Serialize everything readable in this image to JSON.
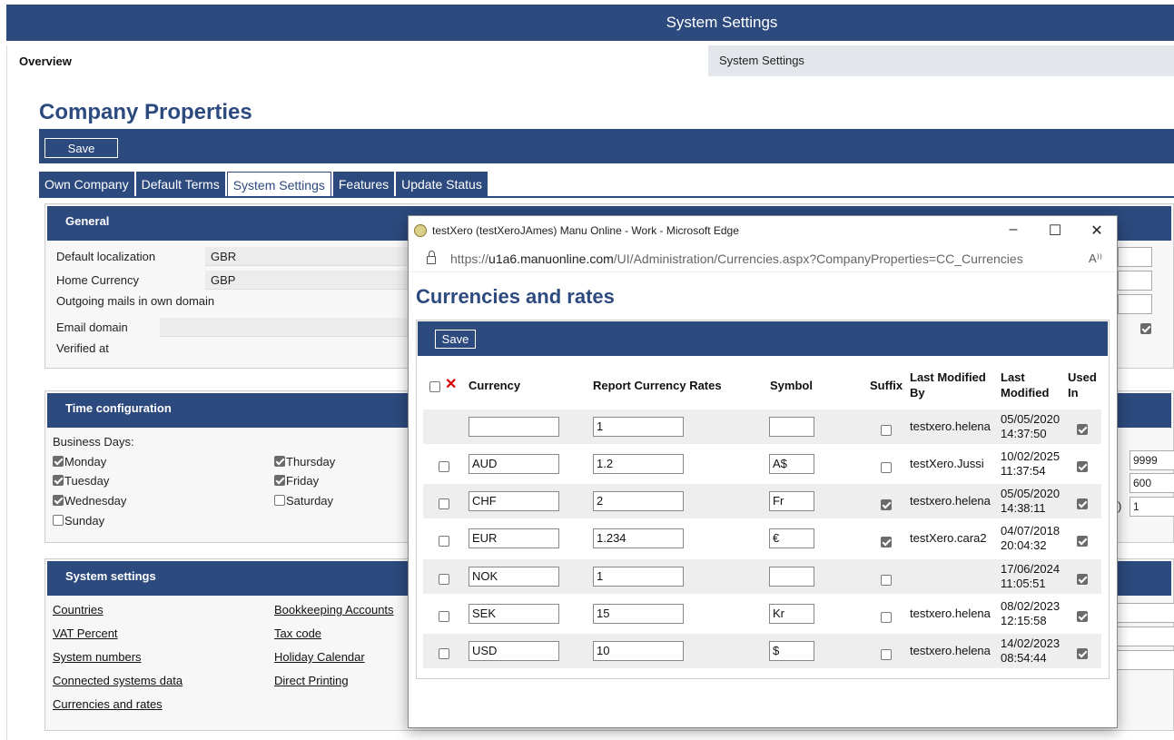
{
  "app": {
    "topbar_title": "System Settings",
    "overview_tab": "Overview",
    "system_settings_tab": "System Settings"
  },
  "company": {
    "title": "Company Properties",
    "save_label": "Save",
    "tabs": [
      "Own Company",
      "Default Terms",
      "System Settings",
      "Features",
      "Update Status"
    ],
    "active_tab": "System Settings"
  },
  "general": {
    "title": "General",
    "default_localization_label": "Default localization",
    "default_localization_value": "GBR",
    "home_currency_label": "Home Currency",
    "home_currency_value": "GBP",
    "outgoing_mails_label": "Outgoing mails in own domain",
    "email_domain_label": "Email domain",
    "verified_at_label": "Verified at"
  },
  "time_config": {
    "title": "Time configuration",
    "business_days_label": "Business Days:",
    "days": [
      {
        "label": "Monday",
        "checked": true
      },
      {
        "label": "Thursday",
        "checked": true
      },
      {
        "label": "Tuesday",
        "checked": true
      },
      {
        "label": "Friday",
        "checked": true
      },
      {
        "label": "Wednesday",
        "checked": true
      },
      {
        "label": "Saturday",
        "checked": false
      },
      {
        "label": "Sunday",
        "checked": false
      }
    ],
    "right_values": [
      "9999",
      "600",
      "1"
    ],
    "paren": ")"
  },
  "system_settings": {
    "title": "System settings",
    "links": [
      "Countries",
      "Bookkeeping Accounts",
      "VAT Percent",
      "Tax code",
      "System numbers",
      "Holiday Calendar",
      "Connected systems data",
      "Direct Printing",
      "Currencies and rates"
    ]
  },
  "popup": {
    "window_title": "testXero (testXeroJAmes) Manu Online - Work - Microsoft Edge",
    "url_prefix": "https://",
    "url_host": "u1a6.manuonline.com",
    "url_path": "/UI/Administration/Currencies.aspx?CompanyProperties=CC_Currencies",
    "heading": "Currencies and rates",
    "save_label": "Save",
    "columns": {
      "currency": "Currency",
      "rates": "Report Currency Rates",
      "symbol": "Symbol",
      "suffix": "Suffix",
      "last_modified_by_1": "Last Modified",
      "last_modified_by_2": "By",
      "last_modified_1": "Last",
      "last_modified_2": "Modified",
      "used_in_1": "Used",
      "used_in_2": "In"
    },
    "rows": [
      {
        "select": null,
        "currency": "",
        "rate": "1",
        "symbol": "",
        "suffix": false,
        "by": "testxero.helena",
        "date": "05/05/2020",
        "time": "14:37:50",
        "used": true
      },
      {
        "select": false,
        "currency": "AUD",
        "rate": "1.2",
        "symbol": "A$",
        "suffix": false,
        "by": "testXero.Jussi",
        "date": "10/02/2025",
        "time": "11:37:54",
        "used": true
      },
      {
        "select": false,
        "currency": "CHF",
        "rate": "2",
        "symbol": "Fr",
        "suffix": true,
        "by": "testxero.helena",
        "date": "05/05/2020",
        "time": "14:38:11",
        "used": true
      },
      {
        "select": false,
        "currency": "EUR",
        "rate": "1.234",
        "symbol": "€",
        "suffix": true,
        "by": "testXero.cara2",
        "date": "04/07/2018",
        "time": "20:04:32",
        "used": true
      },
      {
        "select": false,
        "currency": "NOK",
        "rate": "1",
        "symbol": "",
        "suffix": false,
        "by": "",
        "date": "17/06/2024",
        "time": "11:05:51",
        "used": true
      },
      {
        "select": false,
        "currency": "SEK",
        "rate": "15",
        "symbol": "Kr",
        "suffix": false,
        "by": "testxero.helena",
        "date": "08/02/2023",
        "time": "12:15:58",
        "used": true
      },
      {
        "select": false,
        "currency": "USD",
        "rate": "10",
        "symbol": "$",
        "suffix": false,
        "by": "testxero.helena",
        "date": "14/02/2023",
        "time": "08:54:44",
        "used": true
      }
    ]
  },
  "colors": {
    "brand": "#2c4a7e",
    "delete": "#dd0000"
  }
}
